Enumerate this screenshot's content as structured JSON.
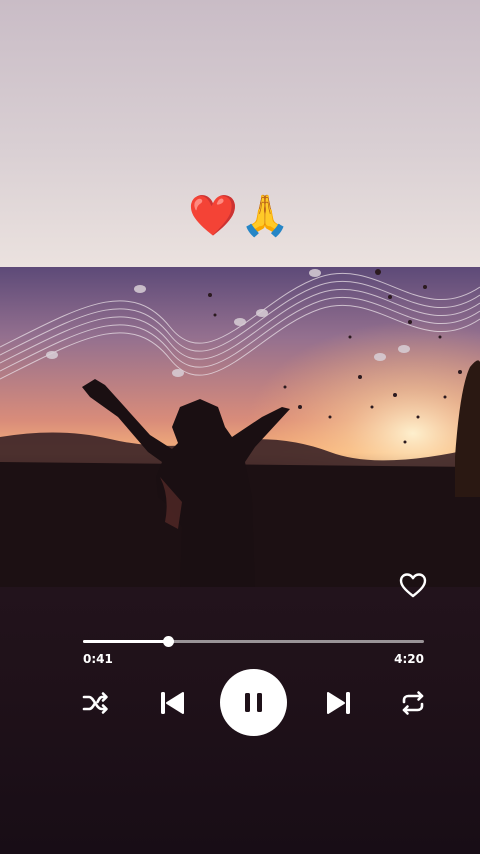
{
  "overlay": {
    "emojis": "❤️🙏"
  },
  "player": {
    "elapsed": "0:41",
    "total": "4:20",
    "progress": 0.25,
    "liked": false,
    "state": "playing"
  },
  "icons": {
    "like": "heart-outline-icon",
    "shuffle": "shuffle-icon",
    "previous": "skip-previous-icon",
    "pause": "pause-icon",
    "next": "skip-next-icon",
    "repeat": "repeat-icon"
  },
  "colors": {
    "controls": "#ffffff",
    "background": "#1f1119"
  }
}
